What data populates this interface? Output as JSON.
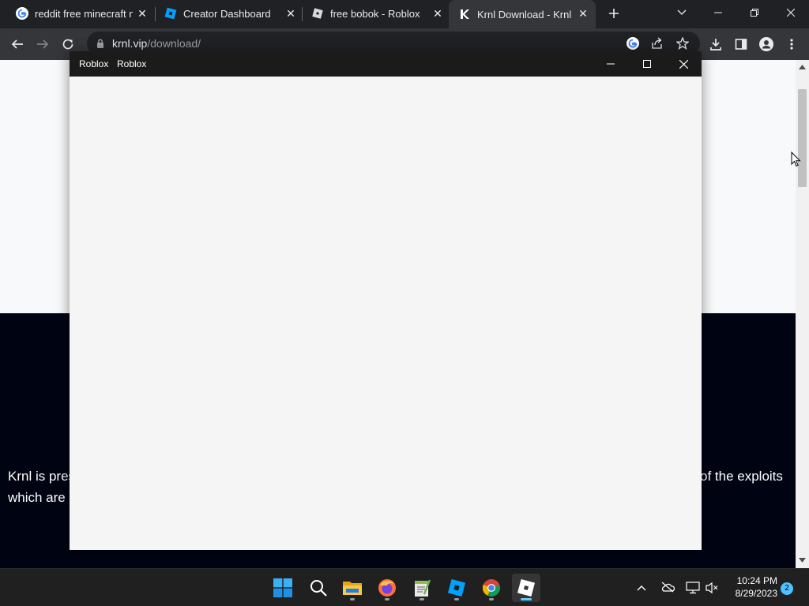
{
  "browser": {
    "tabs": [
      {
        "title": "reddit free minecraft no",
        "favicon": "google-icon"
      },
      {
        "title": "Creator Dashboard",
        "favicon": "roblox-studio-icon"
      },
      {
        "title": "free bobok - Roblox",
        "favicon": "roblox-icon"
      },
      {
        "title": "Krnl Download - Krnl",
        "favicon": "krnl-icon",
        "active": true
      }
    ],
    "url_host": "krnl.vip",
    "url_path": "/download/"
  },
  "page": {
    "line1_left": "Krnl is pres",
    "line1_right": "of the exploits",
    "line2_left": "which are"
  },
  "roblox_window": {
    "title_left": "Roblox",
    "title_right": "Roblox"
  },
  "taskbar": {
    "apps": [
      "start",
      "search",
      "file-explorer",
      "firefox",
      "notepad-plus",
      "roblox-studio",
      "chrome",
      "roblox"
    ],
    "time": "10:24 PM",
    "date": "8/29/2023",
    "notification_count": "2"
  },
  "colors": {
    "tab_strip": "#202124",
    "toolbar": "#35363a",
    "page_light": "#f8f9fb",
    "page_dark": "#000412",
    "roblox_titlebar": "#1b1b1b",
    "taskbar": "#202020"
  }
}
